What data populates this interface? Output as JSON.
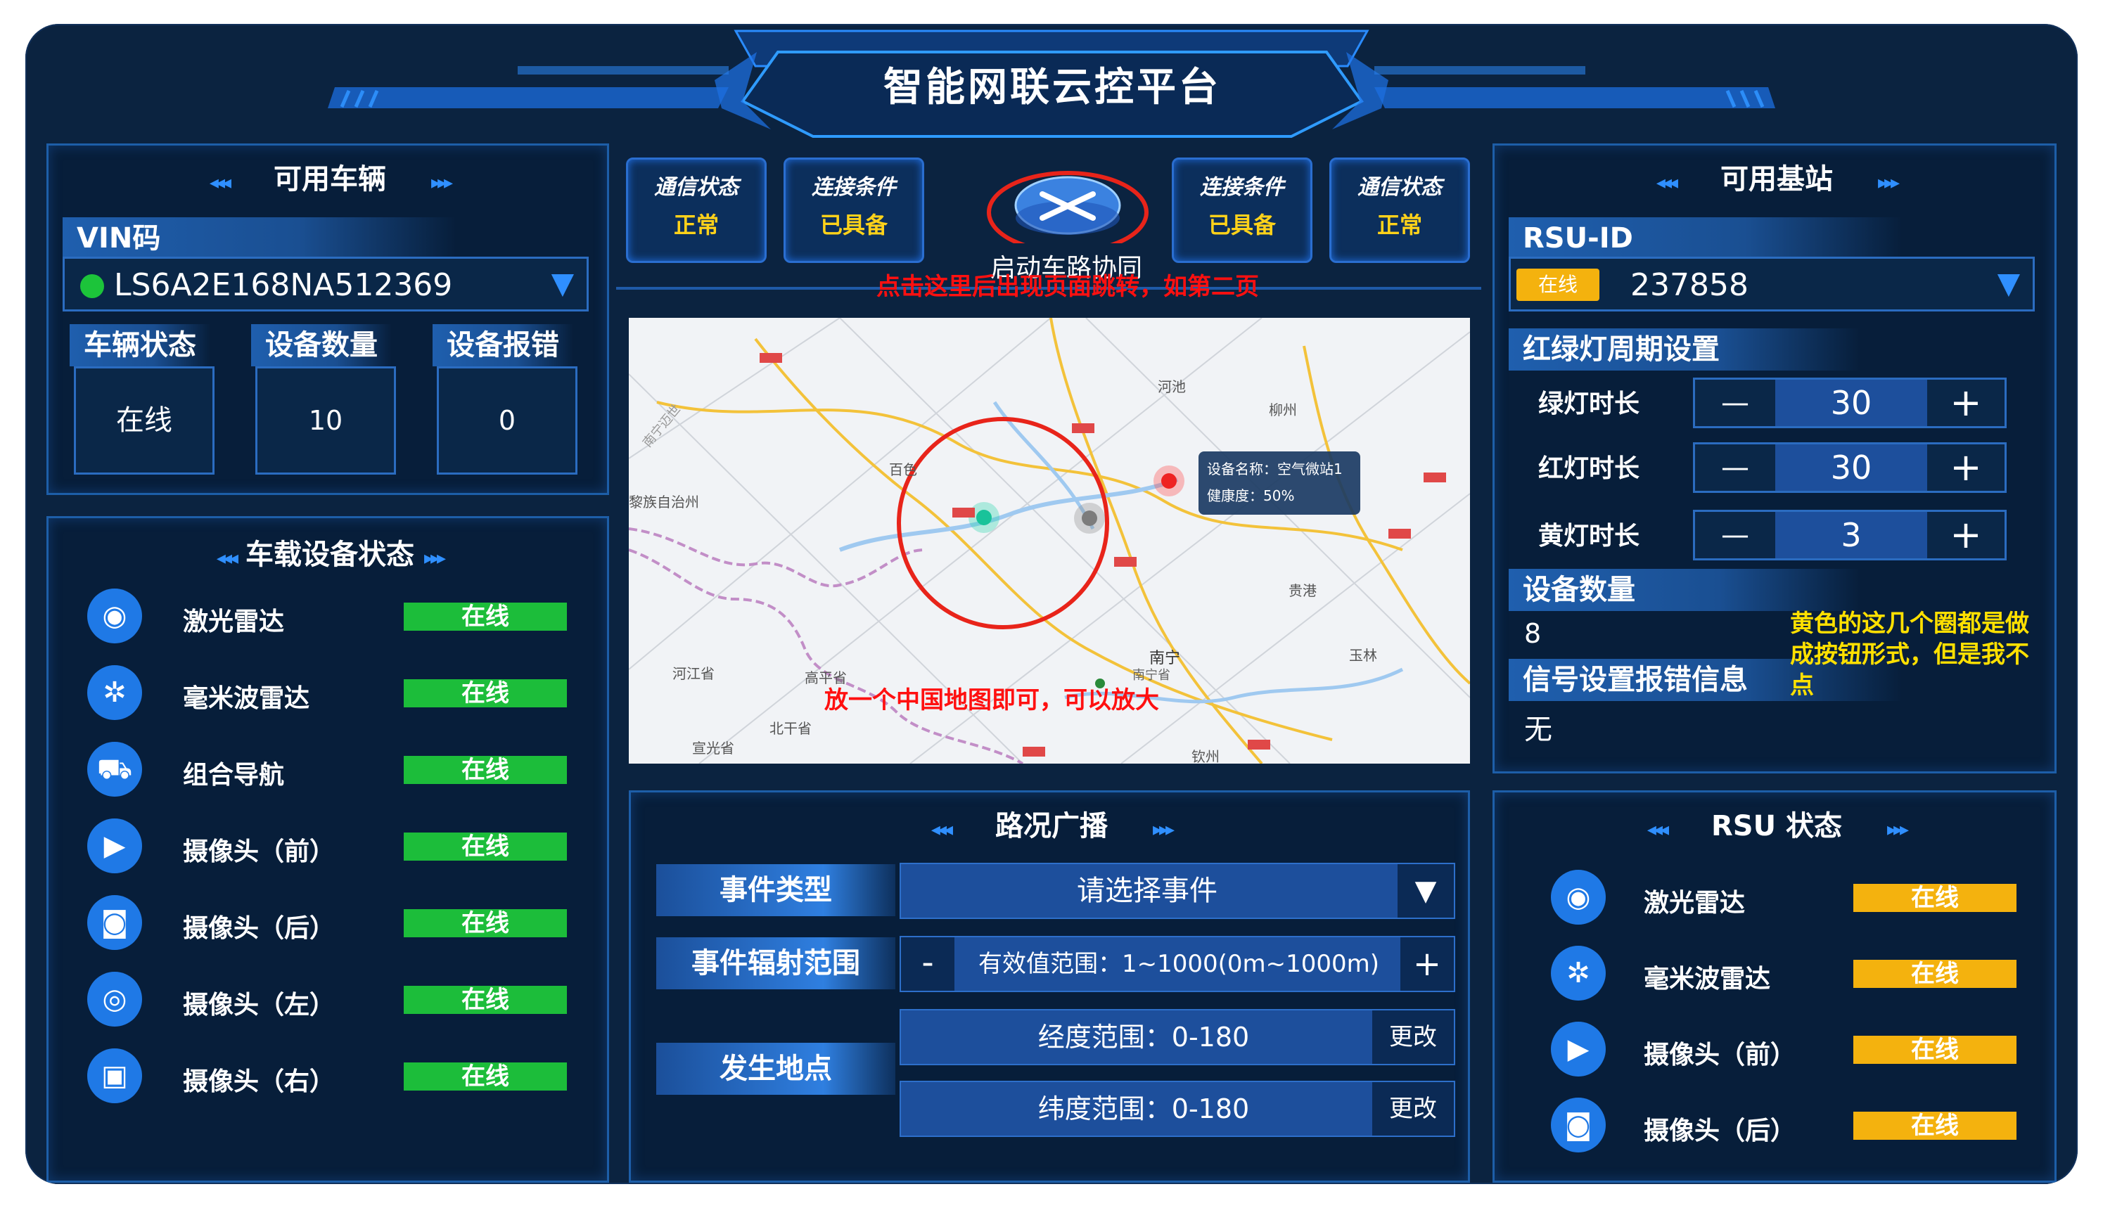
{
  "header": {
    "title": "智能网联云控平台"
  },
  "vehicles": {
    "title": "可用车辆",
    "vin_label": "VIN码",
    "vin_value": "LS6A2E168NA512369",
    "stats": [
      {
        "label": "车辆状态",
        "value": "在线"
      },
      {
        "label": "设备数量",
        "value": "10"
      },
      {
        "label": "设备报错",
        "value": "0"
      }
    ]
  },
  "onboard": {
    "title": "车载设备状态",
    "items": [
      {
        "label": "激光雷达",
        "status": "在线",
        "icon": "lidar-icon"
      },
      {
        "label": "毫米波雷达",
        "status": "在线",
        "icon": "radar-icon"
      },
      {
        "label": "组合导航",
        "status": "在线",
        "icon": "navigation-icon"
      },
      {
        "label": "摄像头（前）",
        "status": "在线",
        "icon": "camera-icon"
      },
      {
        "label": "摄像头（后）",
        "status": "在线",
        "icon": "camera-icon"
      },
      {
        "label": "摄像头（左）",
        "status": "在线",
        "icon": "camera-icon"
      },
      {
        "label": "摄像头（右）",
        "status": "在线",
        "icon": "camera-icon"
      }
    ]
  },
  "center": {
    "status_buttons": [
      {
        "title": "通信状态",
        "value": "正常"
      },
      {
        "title": "连接条件",
        "value": "已具备"
      },
      {
        "title": "连接条件",
        "value": "已具备"
      },
      {
        "title": "通信状态",
        "value": "正常"
      }
    ],
    "start_label": "启动车路协同",
    "annotation_top": "点击这里后出现页面跳转，如第二页",
    "annotation_map": "放一个中国地图即可，可以放大",
    "map_tooltip": {
      "name": "设备名称：空气微站1",
      "health": "健康度：50%"
    },
    "map_labels": [
      "百色",
      "河池",
      "柳州",
      "贵港",
      "南宁",
      "南宁省",
      "玉林",
      "河江省",
      "高平省",
      "北干省",
      "宣光省",
      "钦州",
      "黎族自治州",
      "南宁迈世"
    ]
  },
  "broadcast": {
    "title": "路况广播",
    "event_type_label": "事件类型",
    "event_type_value": "请选择事件",
    "range_label": "事件辐射范围",
    "range_minus": "-",
    "range_value": "有效值范围：1~1000(0m~1000m)",
    "range_plus": "+",
    "location_label": "发生地点",
    "lon_value": "经度范围：0-180",
    "lat_value": "纬度范围：0-180",
    "change_label": "更改"
  },
  "stations": {
    "title": "可用基站",
    "rsu_label": "RSU-ID",
    "online_badge": "在线",
    "rsu_value": "237858",
    "light_title": "红绿灯周期设置",
    "lights": [
      {
        "label": "绿灯时长",
        "value": "30"
      },
      {
        "label": "红灯时长",
        "value": "30"
      },
      {
        "label": "黄灯时长",
        "value": "3"
      }
    ],
    "minus": "—",
    "plus": "+",
    "device_count_title": "设备数量",
    "device_count": "8",
    "error_title": "信号设置报错信息",
    "error_value": "无",
    "note": "黄色的这几个圈都是做成按钮形式，但是我不点"
  },
  "rsu_status": {
    "title": "RSU 状态",
    "items": [
      {
        "label": "激光雷达",
        "status": "在线",
        "icon": "lidar-icon"
      },
      {
        "label": "毫米波雷达",
        "status": "在线",
        "icon": "radar-icon"
      },
      {
        "label": "摄像头（前）",
        "status": "在线",
        "icon": "camera-icon"
      },
      {
        "label": "摄像头（后）",
        "status": "在线",
        "icon": "camera-icon"
      }
    ]
  },
  "colors": {
    "online_green": "#1cbd3a",
    "online_yellow": "#f4b20e",
    "accent_blue": "#1f79e6",
    "annotation_red": "#ff1010",
    "note_yellow": "#ffe000"
  }
}
